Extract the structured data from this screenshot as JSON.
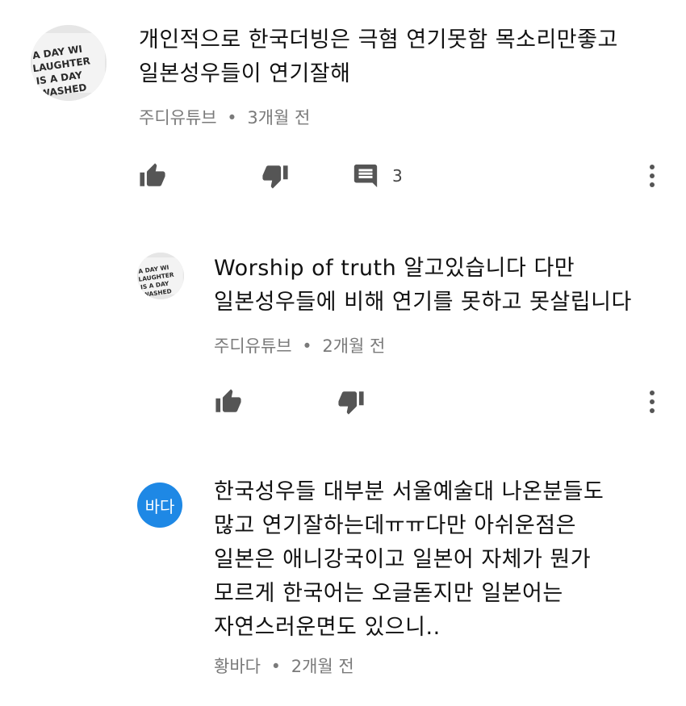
{
  "comments": [
    {
      "avatar": {
        "kind": "photo",
        "lines": [
          "A DAY WI",
          "LAUGHTER",
          "IS A DAY",
          "WASHED"
        ]
      },
      "text_lines": [
        "개인적으로 한국더빙은 극혐 연기못함 목소리만좋고",
        "일본성우들이 연기잘해"
      ],
      "author": "주디유튜브",
      "separator": "•",
      "time": "3개월 전",
      "reply_count": "3"
    },
    {
      "avatar": {
        "kind": "photo",
        "lines": [
          "A DAY WI",
          "LAUGHTER",
          "IS A DAY",
          "WASHED"
        ]
      },
      "text_lines": [
        "Worship of truth 알고있습니다 다만",
        "일본성우들에 비해 연기를 못하고 못살립니다"
      ],
      "author": "주디유튜브",
      "separator": "•",
      "time": "2개월 전"
    },
    {
      "avatar": {
        "kind": "initial",
        "label": "바다",
        "color": "#1e88e5"
      },
      "text_lines": [
        "한국성우들 대부분 서울예술대 나온분들도",
        "많고 연기잘하는데ㅠㅠ다만 아쉬운점은",
        "일본은 애니강국이고 일본어 자체가 뭔가",
        "모르게 한국어는 오글돋지만 일본어는",
        "자연스러운면도 있으니.."
      ],
      "author": "황바다",
      "separator": "•",
      "time": "2개월 전"
    }
  ],
  "icons": {
    "like": "thumbs-up-icon",
    "dislike": "thumbs-down-icon",
    "reply": "comment-icon",
    "more": "more-vertical-icon"
  },
  "colors": {
    "text": "#111111",
    "meta": "#7a7a7a",
    "icon": "#555555",
    "accent_avatar": "#1e88e5"
  }
}
